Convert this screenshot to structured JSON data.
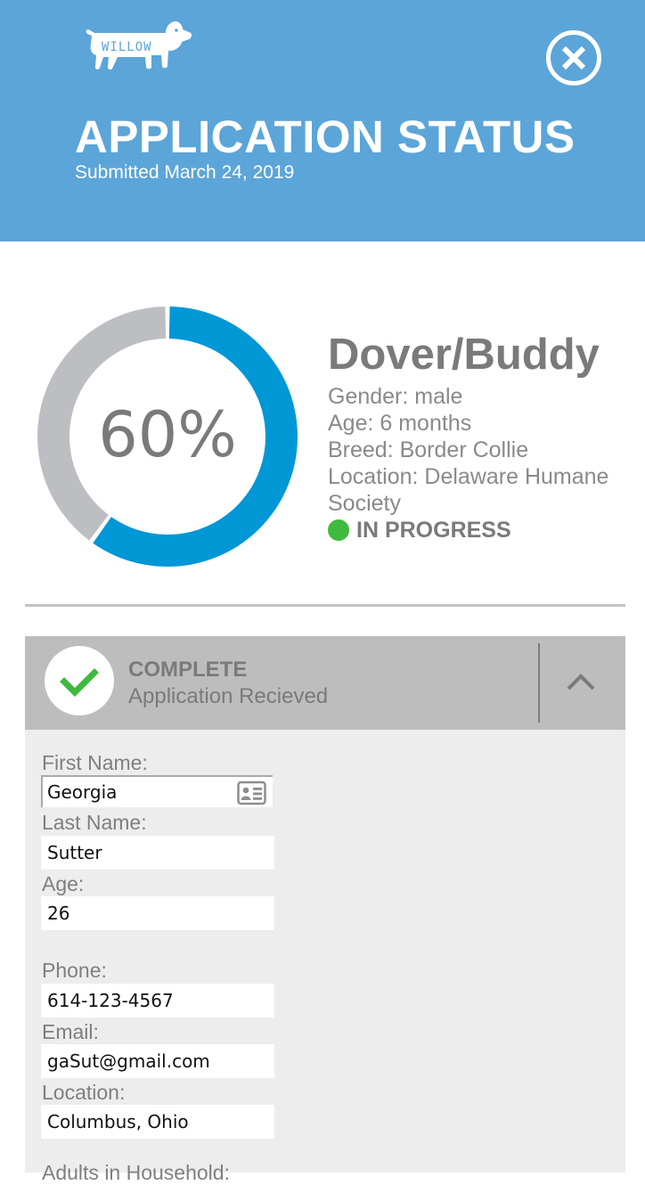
{
  "header": {
    "logo_text": "WILLOW",
    "title": "APPLICATION STATUS",
    "submitted": "Submitted March 24, 2019",
    "close_icon": "close-circle-icon"
  },
  "progress": {
    "percent": 60,
    "label": "60%"
  },
  "pet": {
    "name": "Dover/Buddy",
    "gender": "Gender: male",
    "age": "Age: 6 months",
    "breed": "Breed: Border Collie",
    "location": "Location: Delaware Humane Society",
    "status": "IN PROGRESS",
    "status_color": "#3fba3f"
  },
  "step": {
    "status": "COMPLETE",
    "description": "Application Recieved",
    "check_icon": "checkmark-icon",
    "toggle_icon": "chevron-up-icon"
  },
  "form": {
    "first_name_label": "First Name:",
    "first_name": "Georgia",
    "last_name_label": "Last Name:",
    "last_name": "Sutter",
    "age_label": "Age:",
    "age": "26",
    "phone_label": "Phone:",
    "phone": "614-123-4567",
    "email_label": "Email:",
    "email": "gaSut@gmail.com",
    "location_label": "Location:",
    "location": "Columbus, Ohio",
    "next_label": "Adults in Household:"
  },
  "colors": {
    "header_bg": "#5ba5d9",
    "progress_fill": "#0097d6",
    "progress_track": "#bdbec2"
  }
}
